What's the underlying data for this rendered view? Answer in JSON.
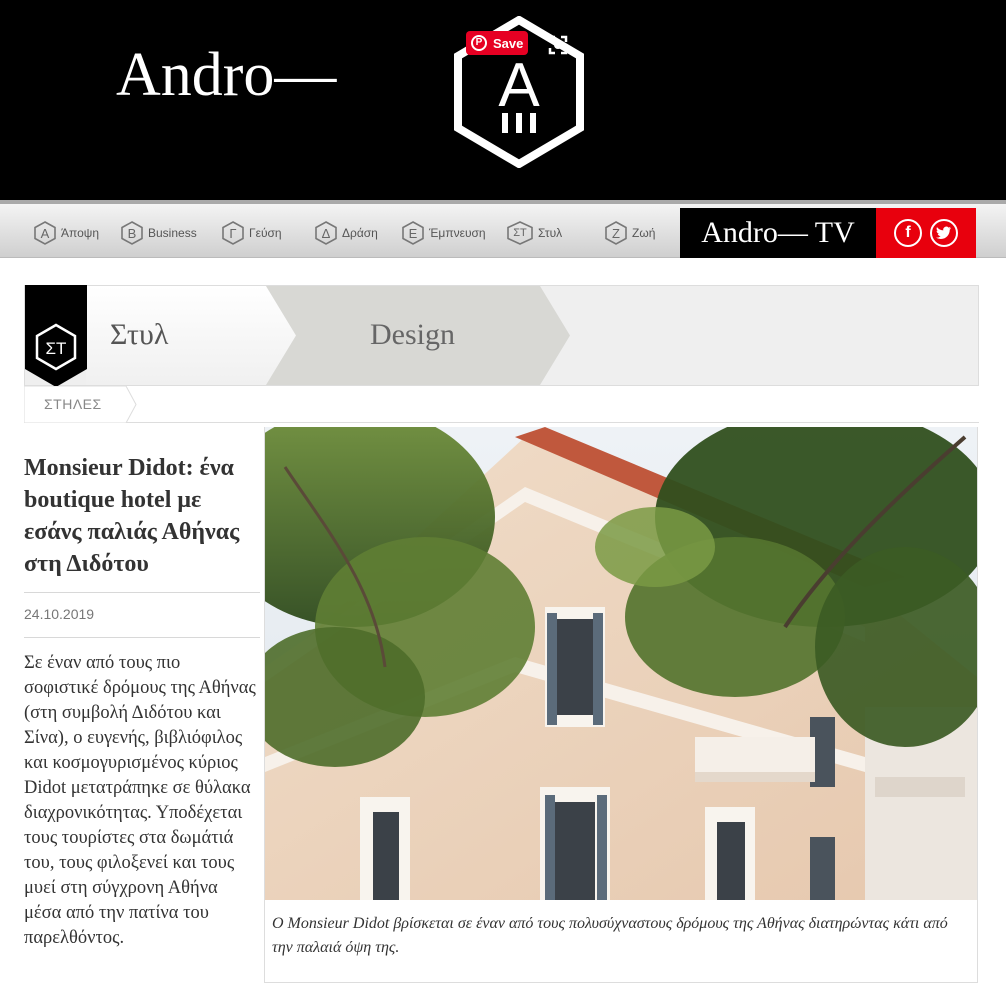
{
  "header": {
    "site_title": "Andro—",
    "logo_letter": "Α",
    "pin_save_label": "Save"
  },
  "nav": {
    "items": [
      {
        "badge": "Α",
        "label": "Άποψη"
      },
      {
        "badge": "Β",
        "label": "Business"
      },
      {
        "badge": "Γ",
        "label": "Γεύση"
      },
      {
        "badge": "Δ",
        "label": "Δράση"
      },
      {
        "badge": "Ε",
        "label": "Έμπνευση"
      },
      {
        "badge": "ΣΤ",
        "label": "Στυλ"
      },
      {
        "badge": "Ζ",
        "label": "Ζωή"
      }
    ],
    "tv_label": "Andro— TV",
    "social": {
      "facebook": "f",
      "twitter": "t"
    }
  },
  "breadcrumb": {
    "section_badge": "ΣΤ",
    "section": "Στυλ",
    "subsection": "Design",
    "columns_label": "ΣΤΗΛΕΣ"
  },
  "article": {
    "title": "Monsieur Didot: ένα boutique hotel με εσάνς παλιάς Αθήνας στη Διδότου",
    "date": "24.10.2019",
    "body": "Σε έναν από τους πιο σοφιστικέ δρόμους της Αθήνας (στη συμβολή Διδότου και Σίνα), ο ευγενής, βιβλιόφιλος και κοσμογυρισμένος κύριος Didot μετατράπηκε σε θύλακα διαχρονικότητας. Υποδέχεται τους τουρίστες στα δωμάτιά του, τους φιλοξενεί και τους μυεί στη σύγχρονη Αθήνα μέσα από την πατίνα του παρελθόντος.",
    "caption": "Ο Monsieur Didot βρίσκεται σε έναν από τους πολυσύχναστους δρόμους της Αθήνας διατηρώντας κάτι από την παλαιά όψη της."
  },
  "colors": {
    "header_bg": "#000000",
    "social_red": "#e8000d",
    "pinterest_red": "#e60023",
    "text_dark": "#333333"
  }
}
